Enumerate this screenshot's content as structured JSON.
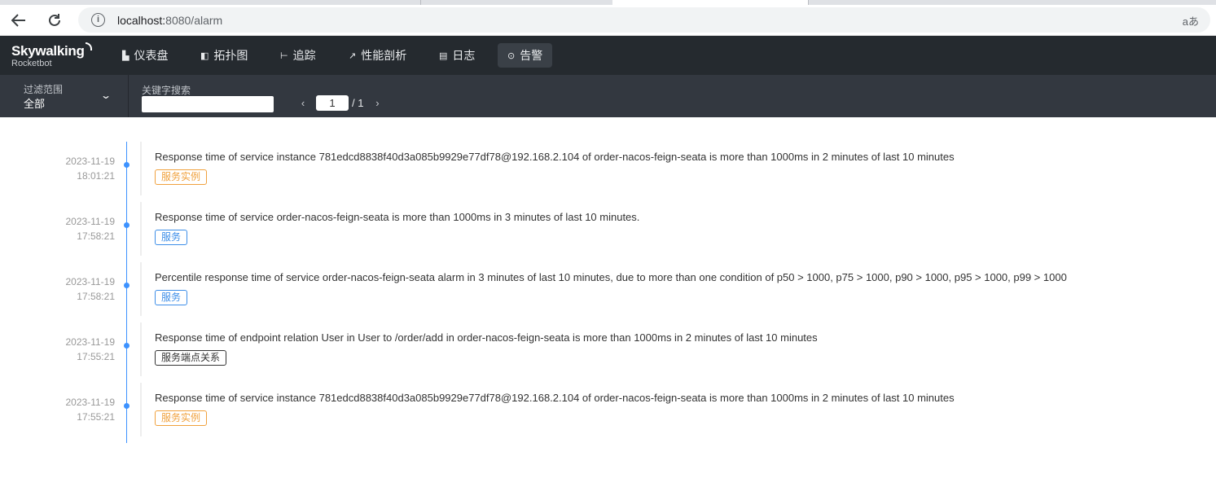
{
  "browser": {
    "url_host": "localhost:",
    "url_port_path": "8080/alarm",
    "back_icon": "arrow-left-icon",
    "reload_icon": "reload-icon",
    "info_glyph": "i",
    "translate_glyph": "aあ"
  },
  "app": {
    "brand": "Skywalking",
    "brand_sub": "Rocketbot",
    "nav": [
      {
        "label": "仪表盘",
        "icon": "dashboard-icon",
        "glyph": "▙"
      },
      {
        "label": "拓扑图",
        "icon": "topology-icon",
        "glyph": "◧"
      },
      {
        "label": "追踪",
        "icon": "trace-icon",
        "glyph": "⊢"
      },
      {
        "label": "性能剖析",
        "icon": "profile-icon",
        "glyph": "↗"
      },
      {
        "label": "日志",
        "icon": "log-icon",
        "glyph": "▤"
      },
      {
        "label": "告警",
        "icon": "alarm-icon",
        "glyph": "⊙",
        "active": true
      }
    ]
  },
  "filter": {
    "scope_label": "过滤范围",
    "scope_value": "全部",
    "keyword_label": "关键字搜索",
    "keyword_value": "",
    "page_current": "1",
    "page_total": "/ 1"
  },
  "alarms": [
    {
      "date": "2023-11-19",
      "time": "18:01:21",
      "message": "Response time of service instance 781edcd8838f40d3a085b9929e77df78@192.168.2.104 of order-nacos-feign-seata is more than 1000ms in 2 minutes of last 10 minutes",
      "tag": "服务实例",
      "tag_color": "#f0a13d"
    },
    {
      "date": "2023-11-19",
      "time": "17:58:21",
      "message": "Response time of service order-nacos-feign-seata is more than 1000ms in 3 minutes of last 10 minutes.",
      "tag": "服务",
      "tag_color": "#3d8ee8"
    },
    {
      "date": "2023-11-19",
      "time": "17:58:21",
      "message": "Percentile response time of service order-nacos-feign-seata alarm in 3 minutes of last 10 minutes, due to more than one condition of p50 > 1000, p75 > 1000, p90 > 1000, p95 > 1000, p99 > 1000",
      "tag": "服务",
      "tag_color": "#3d8ee8"
    },
    {
      "date": "2023-11-19",
      "time": "17:55:21",
      "message": "Response time of endpoint relation User in User to /order/add in order-nacos-feign-seata is more than 1000ms in 2 minutes of last 10 minutes",
      "tag": "服务端点关系",
      "tag_color": "#333333"
    },
    {
      "date": "2023-11-19",
      "time": "17:55:21",
      "message": "Response time of service instance 781edcd8838f40d3a085b9929e77df78@192.168.2.104 of order-nacos-feign-seata is more than 1000ms in 2 minutes of last 10 minutes",
      "tag": "服务实例",
      "tag_color": "#f0a13d"
    }
  ]
}
